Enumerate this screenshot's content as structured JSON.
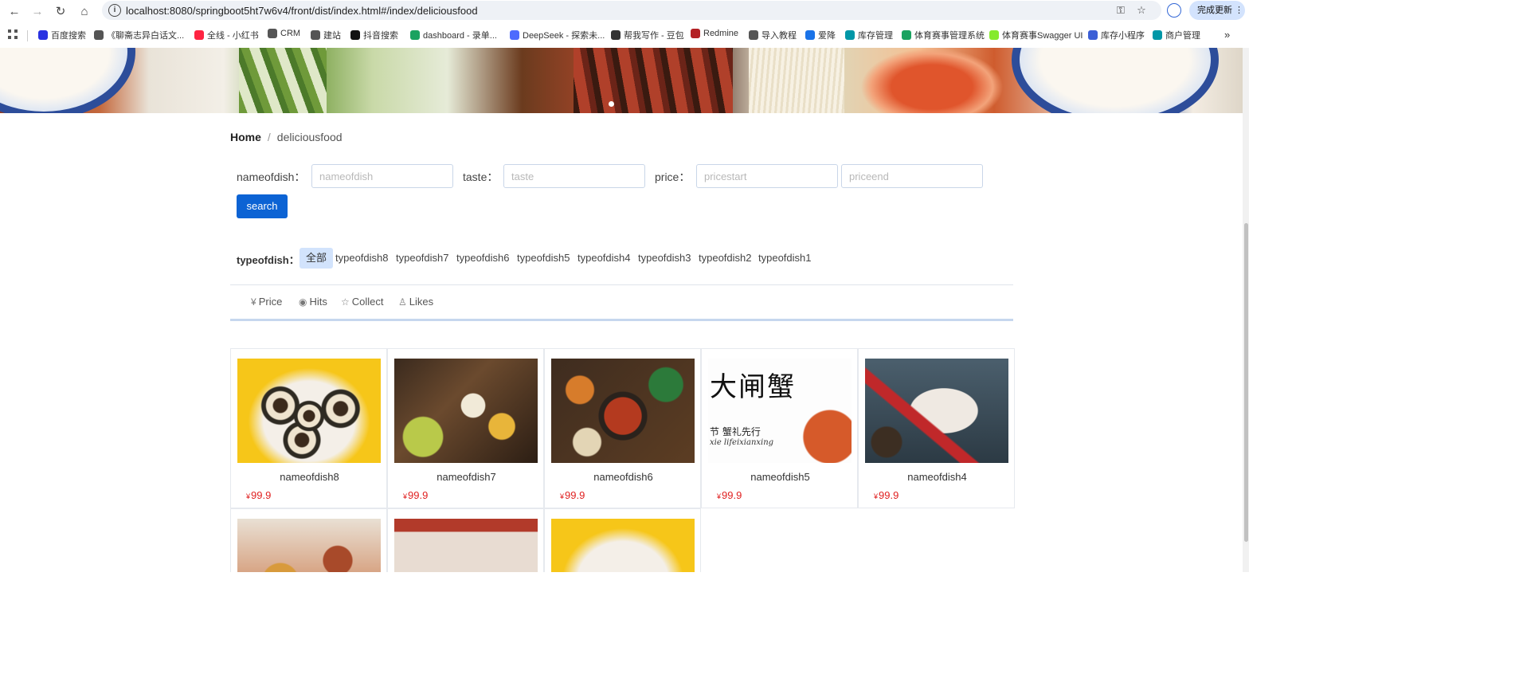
{
  "browser": {
    "url": "localhost:8080/springboot5ht7w6v4/front/dist/index.html#/index/deliciousfood",
    "update_button": "完成更新",
    "bookmarks": [
      {
        "label": "百度搜索",
        "color": "#2932e1"
      },
      {
        "label": "《聊斋志异白话文...",
        "color": "#555555"
      },
      {
        "label": "全线 - 小红书",
        "color": "#ff2442"
      },
      {
        "label": "CRM",
        "color": "#555555"
      },
      {
        "label": "建站",
        "color": "#555555"
      },
      {
        "label": "抖音搜索",
        "color": "#111111"
      },
      {
        "label": "dashboard - 录单...",
        "color": "#1aa260"
      },
      {
        "label": "DeepSeek - 探索未...",
        "color": "#4d6bfe"
      },
      {
        "label": "帮我写作 - 豆包",
        "color": "#333333"
      },
      {
        "label": "Redmine",
        "color": "#b32024"
      },
      {
        "label": "导入教程",
        "color": "#555555"
      },
      {
        "label": "爱降",
        "color": "#1a73e8"
      },
      {
        "label": "库存管理",
        "color": "#0097a7"
      },
      {
        "label": "体育赛事管理系统",
        "color": "#1aa260"
      },
      {
        "label": "体育赛事Swagger UI",
        "color": "#85ea2d"
      },
      {
        "label": "库存小程序",
        "color": "#3c5fd6"
      },
      {
        "label": "商户管理",
        "color": "#0097a7"
      }
    ]
  },
  "breadcrumb": {
    "home": "Home",
    "separator": "/",
    "current": "deliciousfood"
  },
  "search": {
    "name_label": "nameofdish：",
    "name_placeholder": "nameofdish",
    "taste_label": "taste：",
    "taste_placeholder": "taste",
    "price_label": "price：",
    "price_start_placeholder": "pricestart",
    "price_end_placeholder": "priceend",
    "button": "search",
    "button_color": "#0c63d4"
  },
  "types": {
    "label": "typeofdish：",
    "items": [
      "全部",
      "typeofdish8",
      "typeofdish7",
      "typeofdish6",
      "typeofdish5",
      "typeofdish4",
      "typeofdish3",
      "typeofdish2",
      "typeofdish1"
    ],
    "active_index": 0
  },
  "sort": {
    "items": [
      {
        "icon": "yen-icon",
        "label": "Price"
      },
      {
        "icon": "eye-icon",
        "label": "Hits"
      },
      {
        "icon": "star-icon",
        "label": "Collect"
      },
      {
        "icon": "thumbs-up-icon",
        "label": "Likes"
      }
    ]
  },
  "dishes": [
    {
      "name": "nameofdish8",
      "currency": "¥",
      "price": "99.9"
    },
    {
      "name": "nameofdish7",
      "currency": "¥",
      "price": "99.9"
    },
    {
      "name": "nameofdish6",
      "currency": "¥",
      "price": "99.9"
    },
    {
      "name": "nameofdish5",
      "currency": "¥",
      "price": "99.9"
    },
    {
      "name": "nameofdish4",
      "currency": "¥",
      "price": "99.9"
    },
    {
      "name": "",
      "currency": "",
      "price": ""
    },
    {
      "name": "",
      "currency": "",
      "price": ""
    },
    {
      "name": "",
      "currency": "",
      "price": ""
    }
  ],
  "dish4_image_text": {
    "line1": "大闸蟹",
    "line2": "节 蟹礼先行",
    "line3": "xie lifeixianxing"
  },
  "colors": {
    "accent": "#0c63d4",
    "price": "#e02020",
    "active_tag": "#d2e3fc"
  }
}
